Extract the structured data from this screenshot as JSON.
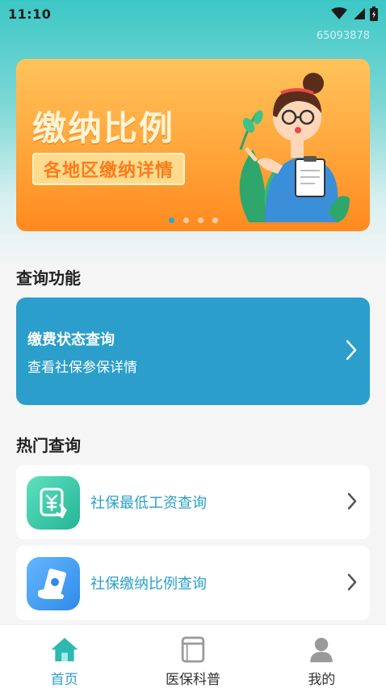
{
  "status": {
    "time": "11:10"
  },
  "header": {
    "user_id": "65093878"
  },
  "banner": {
    "title": "缴纳比例",
    "subtitle": "各地区缴纳详情",
    "page_count": 4,
    "active_page": 1
  },
  "query_section": {
    "title": "查询功能",
    "card": {
      "title": "缴费状态查询",
      "subtitle": "查看社保参保详情"
    }
  },
  "hot_section": {
    "title": "热门查询",
    "items": [
      {
        "label": "社保最低工资查询",
        "icon": "yuan-receipt-icon"
      },
      {
        "label": "社保缴纳比例查询",
        "icon": "money-hand-icon"
      }
    ]
  },
  "tabbar": {
    "tabs": [
      {
        "label": "首页",
        "icon": "home-icon",
        "active": true
      },
      {
        "label": "医保科普",
        "icon": "book-icon",
        "active": false
      },
      {
        "label": "我的",
        "icon": "user-icon",
        "active": false
      }
    ]
  },
  "colors": {
    "accent": "#2aa0c8",
    "card_bg": "#2b9ecb",
    "banner_orange": "#ffa53a",
    "header_teal": "#3cc7c5"
  }
}
